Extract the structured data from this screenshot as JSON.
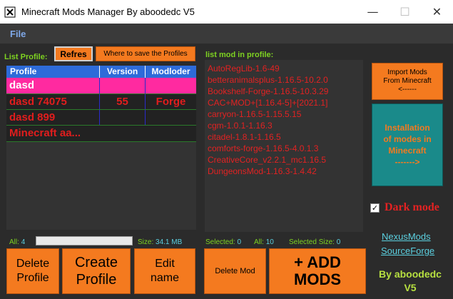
{
  "window": {
    "title": "Minecraft Mods Manager By aboodedc V5"
  },
  "menu": {
    "file": "File"
  },
  "profiles": {
    "label": "List Profile:",
    "refresh": "Refres",
    "where_save": "Where to save the Profiles",
    "columns": [
      "Profile",
      "Version",
      "Modloder"
    ],
    "rows": [
      {
        "profile": "dasd",
        "version": "",
        "modloader": ""
      },
      {
        "profile": "dasd 74075",
        "version": "55",
        "modloader": "Forge"
      },
      {
        "profile": "dasd 899",
        "version": "",
        "modloader": ""
      },
      {
        "profile": "Minecraft aa...",
        "version": "",
        "modloader": ""
      }
    ],
    "all_label": "All:",
    "all_value": "4",
    "size_label": "Size:",
    "size_value": "34.1 MB"
  },
  "mods": {
    "label": "list mod in profile:",
    "items": [
      "AutoRegLib-1.6-49",
      "betteranimalsplus-1.16.5-10.2.0",
      "Bookshelf-Forge-1.16.5-10.3.29",
      "CAC+MOD+[1.16.4-5]+[2021.1]",
      "carryon-1.16.5-1.15.5.15",
      "cgm-1.0.1-1.16.3",
      "citadel-1.8.1-1.16.5",
      "comforts-forge-1.16.5-4.0.1.3",
      "CreativeCore_v2.2.1_mc1.16.5",
      "DungeonsMod-1.16.3-1.4.42"
    ],
    "selected_label": "Selected:",
    "selected_value": "0",
    "all_label": "All:",
    "all_value": "10",
    "selected_size_label": "Selected Size:",
    "selected_size_value": "0"
  },
  "buttons": {
    "import_line1": "Import Mods",
    "import_line2": "From Minecraft",
    "import_line3": "<------",
    "install_line1": "Installation",
    "install_line2": "of modes in",
    "install_line3": "Minecraft",
    "install_line4": "------->",
    "delete_profile_1": "Delete",
    "delete_profile_2": "Profile",
    "create_profile_1": "Create",
    "create_profile_2": "Profile",
    "edit_name_1": "Edit",
    "edit_name_2": "name",
    "delete_mod": "Delete Mod",
    "add_mods_1": "+ ADD",
    "add_mods_2": "MODS"
  },
  "dark_mode": {
    "label": "Dark mode",
    "checked": true
  },
  "links": {
    "nexus": "NexusMods",
    "sourceforge": "SourceForge"
  },
  "credit": {
    "line1": "By aboodedc",
    "line2": "V5"
  },
  "colors": {
    "accent": "#f47a1f",
    "teal": "#1a8a8a",
    "selection": "#ff2aa0",
    "header": "#2e6bd9"
  }
}
